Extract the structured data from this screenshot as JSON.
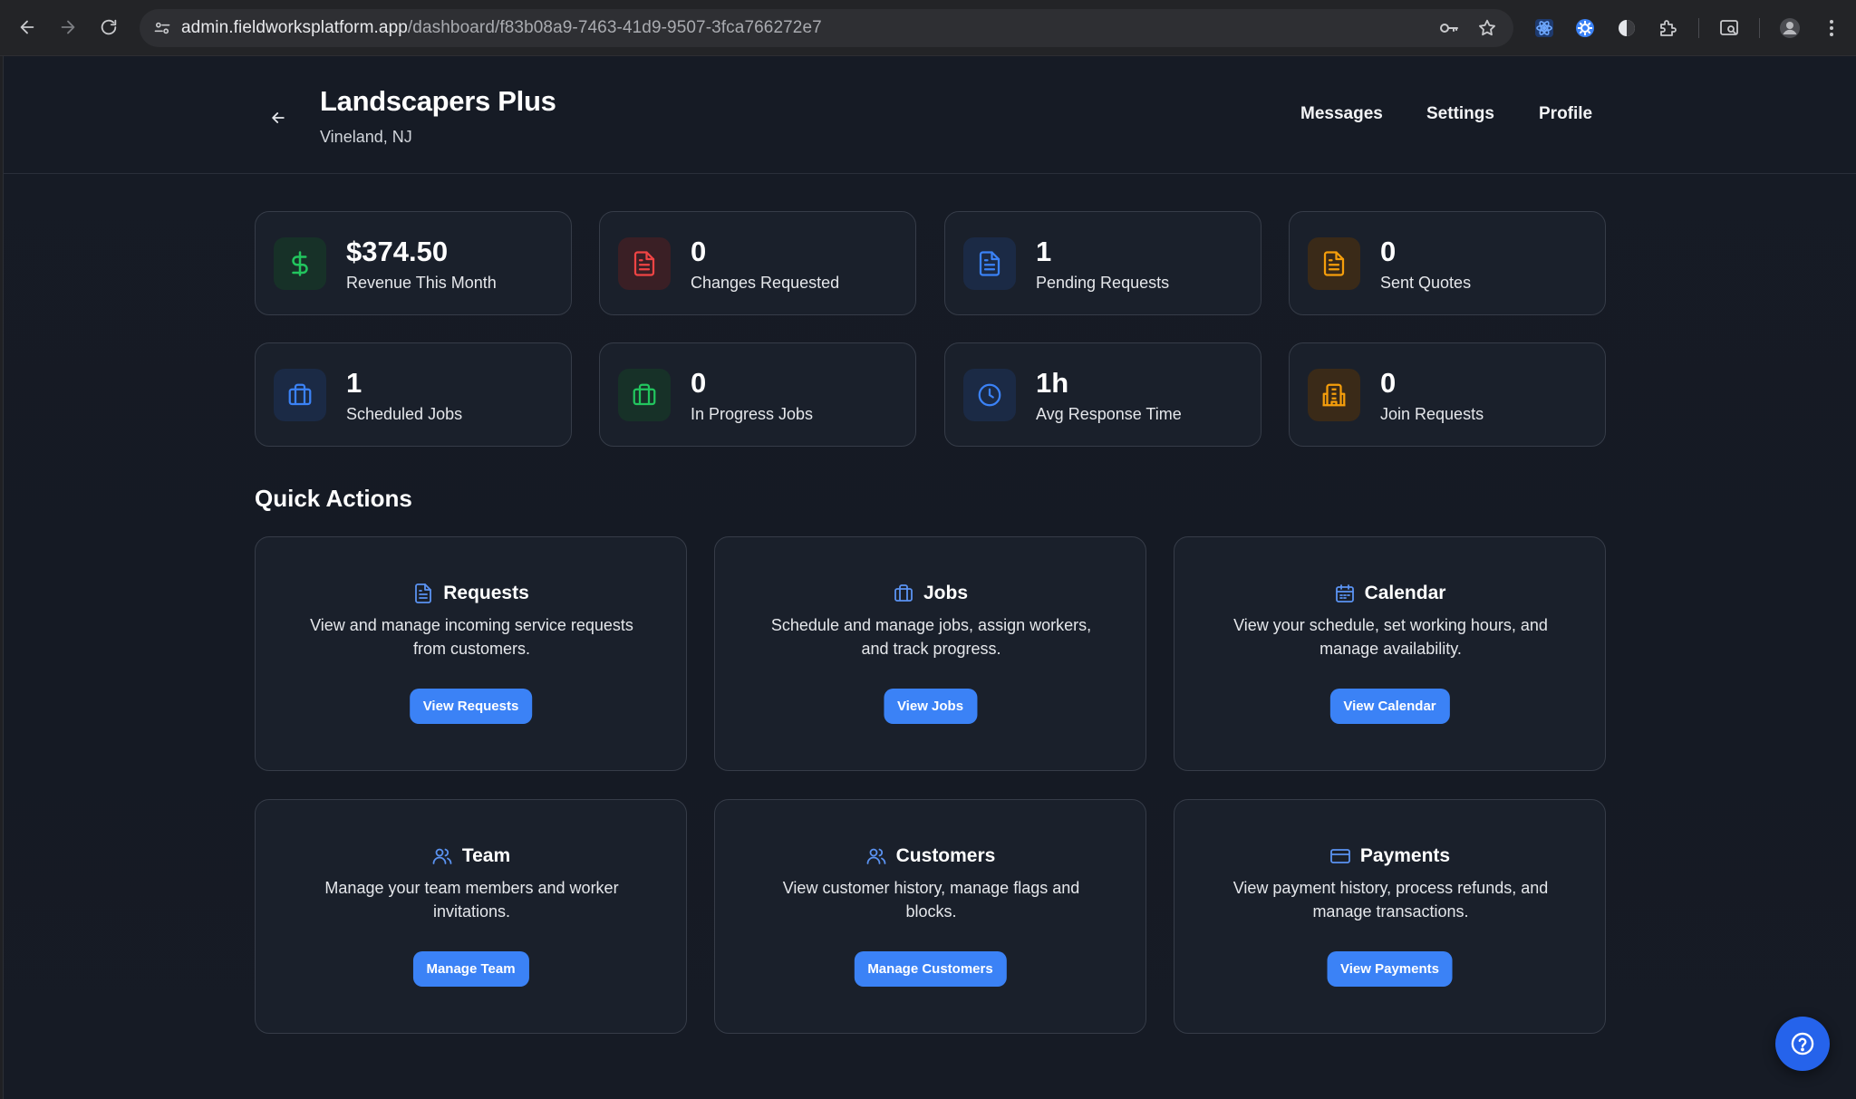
{
  "browser": {
    "url_host": "admin.fieldworksplatform.app",
    "url_path": "/dashboard/f83b08a9-7463-41d9-9507-3fca766272e7"
  },
  "header": {
    "title": "Landscapers Plus",
    "location": "Vineland, NJ",
    "nav": {
      "messages": "Messages",
      "settings": "Settings",
      "profile": "Profile"
    }
  },
  "stats": [
    {
      "value": "$374.50",
      "label": "Revenue This Month",
      "icon": "dollar-icon",
      "color": "#22c55e"
    },
    {
      "value": "0",
      "label": "Changes Requested",
      "icon": "document-icon",
      "color": "#ef4444"
    },
    {
      "value": "1",
      "label": "Pending Requests",
      "icon": "document-icon",
      "color": "#3b82f6"
    },
    {
      "value": "0",
      "label": "Sent Quotes",
      "icon": "document-icon",
      "color": "#f59e0b"
    },
    {
      "value": "1",
      "label": "Scheduled Jobs",
      "icon": "briefcase-icon",
      "color": "#3b82f6"
    },
    {
      "value": "0",
      "label": "In Progress Jobs",
      "icon": "briefcase-icon",
      "color": "#22c55e"
    },
    {
      "value": "1h",
      "label": "Avg Response Time",
      "icon": "clock-icon",
      "color": "#3b82f6"
    },
    {
      "value": "0",
      "label": "Join Requests",
      "icon": "building-icon",
      "color": "#f59e0b"
    }
  ],
  "quick_actions": {
    "title": "Quick Actions",
    "items": [
      {
        "title": "Requests",
        "description": "View and manage incoming service requests from customers.",
        "button": "View Requests",
        "icon": "document-icon"
      },
      {
        "title": "Jobs",
        "description": "Schedule and manage jobs, assign workers, and track progress.",
        "button": "View Jobs",
        "icon": "briefcase-icon"
      },
      {
        "title": "Calendar",
        "description": "View your schedule, set working hours, and manage availability.",
        "button": "View Calendar",
        "icon": "calendar-icon"
      },
      {
        "title": "Team",
        "description": "Manage your team members and worker invitations.",
        "button": "Manage Team",
        "icon": "users-icon"
      },
      {
        "title": "Customers",
        "description": "View customer history, manage flags and blocks.",
        "button": "Manage Customers",
        "icon": "users-icon"
      },
      {
        "title": "Payments",
        "description": "View payment history, process refunds, and manage transactions.",
        "button": "View Payments",
        "icon": "credit-card-icon"
      }
    ]
  },
  "colors": {
    "accent": "#3b82f6",
    "background": "#151a24",
    "card": "#1a202b"
  }
}
